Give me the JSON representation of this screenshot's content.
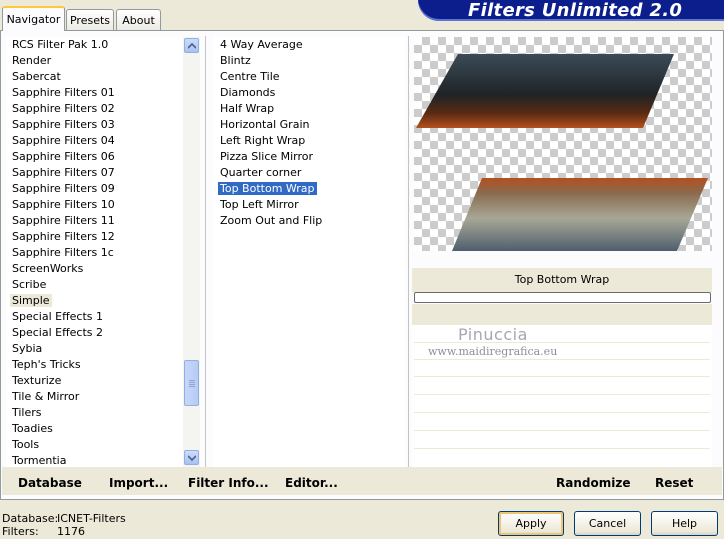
{
  "tabs": {
    "navigator": "Navigator",
    "presets": "Presets",
    "about": "About"
  },
  "title": "Filters Unlimited 2.0",
  "categories": [
    "RCS Filter Pak 1.0",
    "Render",
    "Sabercat",
    "Sapphire Filters 01",
    "Sapphire Filters 02",
    "Sapphire Filters 03",
    "Sapphire Filters 04",
    "Sapphire Filters 06",
    "Sapphire Filters 07",
    "Sapphire Filters 09",
    "Sapphire Filters 10",
    "Sapphire Filters 11",
    "Sapphire Filters 12",
    "Sapphire Filters 1c",
    "ScreenWorks",
    "Scribe",
    "Simple",
    "Special Effects 1",
    "Special Effects 2",
    "Sybia",
    "Teph's Tricks",
    "Texturize",
    "Tile & Mirror",
    "Tilers",
    "Toadies",
    "Tools",
    "Tormentia"
  ],
  "selected_category": "Simple",
  "filters": [
    "4 Way Average",
    "Blintz",
    "Centre Tile",
    "Diamonds",
    "Half Wrap",
    "Horizontal Grain",
    "Left Right Wrap",
    "Pizza Slice Mirror",
    "Quarter corner",
    "Top Bottom Wrap",
    "Top Left Mirror",
    "Zoom Out and Flip"
  ],
  "selected_filter": "Top Bottom Wrap",
  "preview_filter_name": "Top Bottom Wrap",
  "watermark": {
    "line1": "Pinuccia",
    "line2": "www.maidiregrafica.eu"
  },
  "actions": {
    "database": "Database",
    "import": "Import...",
    "filter_info": "Filter Info...",
    "editor": "Editor...",
    "randomize": "Randomize",
    "reset": "Reset"
  },
  "status": {
    "database_label": "Database:",
    "database_value": "ICNET-Filters",
    "filters_label": "Filters:",
    "filters_value": "1176"
  },
  "buttons": {
    "apply": "Apply",
    "cancel": "Cancel",
    "help": "Help"
  },
  "colors": {
    "banner": "#0c1d8c",
    "selection": "#316ac5",
    "window": "#ece9d8"
  }
}
